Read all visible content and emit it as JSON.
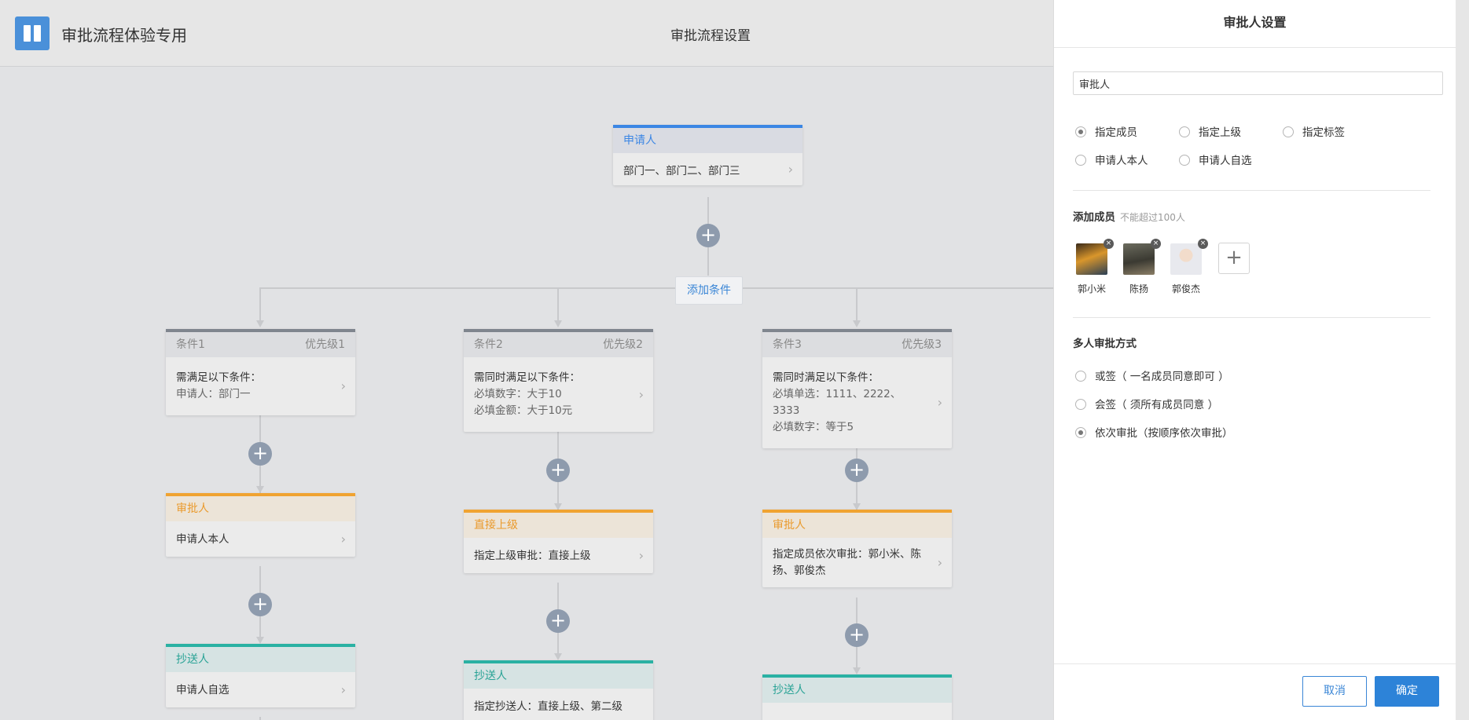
{
  "header": {
    "app_title": "审批流程体验专用",
    "page_title": "审批流程设置"
  },
  "canvas": {
    "add_condition_label": "添加条件",
    "add_icon": "+",
    "chevron": "›",
    "applicant": {
      "header": "申请人",
      "body": "部门一、部门二、部门三"
    },
    "branches": [
      {
        "condition": {
          "header": "条件1",
          "priority": "优先级1",
          "line1": "需满足以下条件：",
          "line2": "申请人：部门一",
          "line3": ""
        },
        "approver": {
          "header": "审批人",
          "body": "申请人本人"
        },
        "cc": {
          "header": "抄送人",
          "body": "申请人自选"
        }
      },
      {
        "condition": {
          "header": "条件2",
          "priority": "优先级2",
          "line1": "需同时满足以下条件：",
          "line2": "必填数字：大于10",
          "line3": "必填金额：大于10元"
        },
        "approver": {
          "header": "直接上级",
          "body": "指定上级审批：直接上级"
        },
        "cc": {
          "header": "抄送人",
          "body": "指定抄送人：直接上级、第二级"
        }
      },
      {
        "condition": {
          "header": "条件3",
          "priority": "优先级3",
          "line1": "需同时满足以下条件：",
          "line2": "必填单选：1111、2222、3333",
          "line3": "必填数字：等于5"
        },
        "approver": {
          "header": "审批人",
          "body": "指定成员依次审批：郭小米、陈扬、郭俊杰"
        },
        "cc": {
          "header": "抄送人",
          "body": ""
        }
      }
    ]
  },
  "panel": {
    "title": "审批人设置",
    "name_value": "审批人",
    "type_options": [
      "指定成员",
      "指定上级",
      "指定标签",
      "申请人本人",
      "申请人自选"
    ],
    "type_selected": "指定成员",
    "members_label": "添加成员",
    "members_hint": "不能超过100人",
    "members": [
      "郭小米",
      "陈扬",
      "郭俊杰"
    ],
    "remove_icon": "×",
    "add_member_icon": "+",
    "mode_label": "多人审批方式",
    "mode_options": [
      "或签（ 一名成员同意即可 ）",
      "会签（ 须所有成员同意 ）",
      "依次审批（按顺序依次审批）"
    ],
    "mode_selected": "依次审批（按顺序依次审批）",
    "cancel_label": "取消",
    "ok_label": "确定"
  },
  "colors": {
    "applicant_accent": "#3b86e4",
    "condition_accent": "#7f858e",
    "approver_accent": "#f0a331",
    "cc_accent": "#2ab1a3",
    "primary_button": "#2d83d8"
  }
}
